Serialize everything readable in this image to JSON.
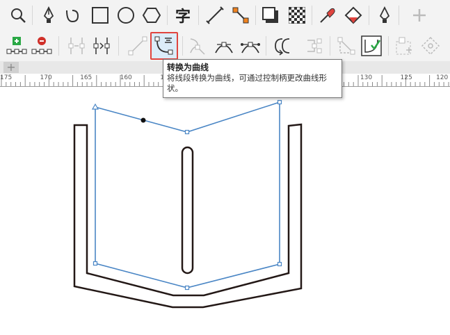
{
  "toolbar_top": {
    "tools": [
      "zoom-tool",
      "freehand-pen-tool",
      "spiral-tool",
      "rectangle-tool",
      "ellipse-tool",
      "polygon-tool",
      "text-tool",
      "dimension-tool",
      "connector-tool",
      "shadow-tool",
      "transparency-tool",
      "eyedropper-tool",
      "interactive-fill-tool",
      "smart-fill-tool",
      "add-tool"
    ],
    "text_tool_glyph": "字"
  },
  "toolbar_nodes": {
    "tools": [
      "add-node",
      "delete-node",
      "join-nodes",
      "break-curve",
      "convert-to-line",
      "convert-to-curve",
      "cusp-node",
      "smooth-node",
      "symmetrical-node",
      "reverse-direction",
      "extract-subpath",
      "extend-curve-to-close",
      "close-curve",
      "reflect-nodes",
      "elastic-mode"
    ]
  },
  "ruler": {
    "labels": [
      "175",
      "170",
      "165",
      "160",
      "155",
      "150",
      "145",
      "140",
      "135",
      "130",
      "125",
      "120"
    ]
  },
  "tooltip": {
    "title": "转换为曲线",
    "description": "将线段转换为曲线，可通过控制柄更改曲线形状。"
  },
  "colors": {
    "selection_path": "#4a86c5",
    "shape_stroke": "#231816",
    "highlight_border": "#e0443e"
  }
}
